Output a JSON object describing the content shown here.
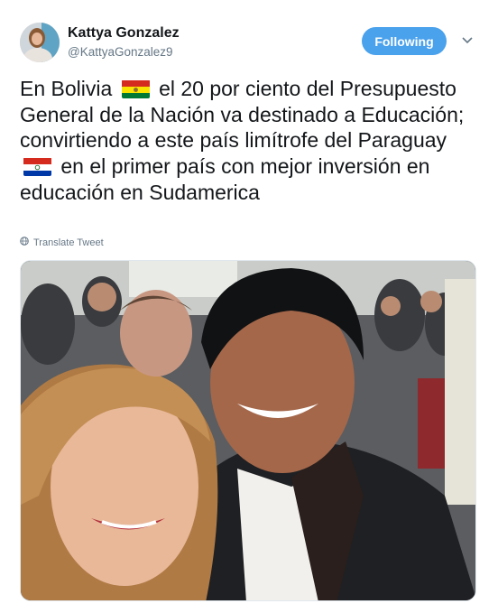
{
  "author": {
    "name": "Kattya Gonzalez",
    "handle": "@KattyaGonzalez9",
    "avatar_icon": "profile-photo"
  },
  "follow_button": {
    "label": "Following",
    "color": "#4aa1ec"
  },
  "menu_icon": "chevron-down-icon",
  "tweet": {
    "part1": "En Bolivia",
    "flag1": "bolivia-flag",
    "part2": "el 20 por ciento del Presupuesto General de la Nación va destinado a Educación; convirtiendo a este país limítrofe del Paraguay",
    "flag2": "paraguay-flag",
    "part3": "en el primer país con mejor inversión en educación en Sudamerica"
  },
  "translate": {
    "label": "Translate Tweet",
    "icon": "globe-icon"
  },
  "media": {
    "type": "photo",
    "subject": "selfie-photo"
  }
}
